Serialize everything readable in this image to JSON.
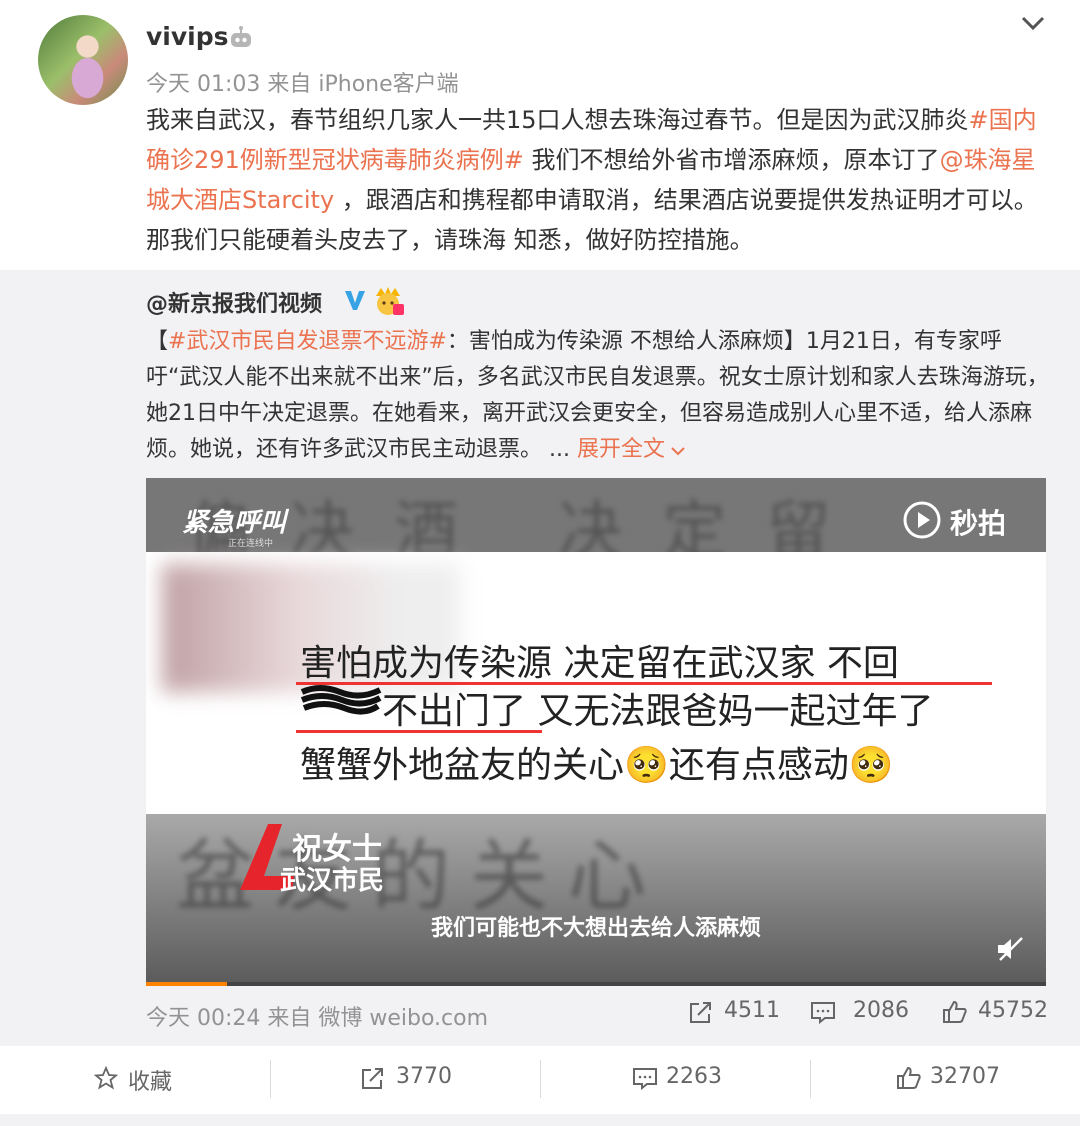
{
  "post": {
    "username": "vivips",
    "meta": "今天 01:03 来自 iPhone客户端",
    "text_1": "我来自武汉，春节组织几家人一共15口人想去珠海过春节。但是因为武汉肺炎",
    "hashtag": "#国内确诊291例新型冠状病毒肺炎病例#",
    "text_2": " 我们不想给外省市增添麻烦，原本订了",
    "mention": "@珠海星城大酒店Starcity",
    "text_3": " ，跟酒店和携程都申请取消，结果酒店说要提供发热证明才可以。那我们只能硬着头皮去了，请珠海 知悉，做好防控措施。"
  },
  "repost": {
    "author": "@新京报我们视频",
    "text_open": "【",
    "hashtag": "#武汉市民自发退票不远游#",
    "text_body": "：害怕成为传染源 不想给人添麻烦】1月21日，有专家呼吁“武汉人能不出来就不出来”后，多名武汉市民自发退票。祝女士原计划和家人去珠海游玩，她21日中午决定退票。在她看来，离开武汉会更安全，但容易造成别人心里不适，给人添麻烦。她说，还有许多武汉市民主动退票。 ... ",
    "expand": "展开全文",
    "meta": "今天 00:24 来自 微博 weibo.com",
    "stats": {
      "reposts": "4511",
      "comments": "2086",
      "likes": "45752"
    }
  },
  "video": {
    "top_blur": "偏决酒 决定留",
    "logo": "紧急呼叫",
    "logo_sub": "正在连线中",
    "brand": "秒拍",
    "line1": "害怕成为传染源 决定留在武汉家 不回",
    "line2": "不出门了 又无法跟爸妈一起过年了",
    "line3": "蟹蟹外地盆友的关心🥺还有点感动🥺",
    "bottom_blur": "盆友的关心",
    "speaker_name": "祝女士",
    "speaker_role": "武汉市民",
    "subtitle": "我们可能也不大想出去给人添麻烦",
    "progress": 0.09
  },
  "actions": {
    "favorite": "收藏",
    "repost": "3770",
    "comment": "2263",
    "like": "32707"
  },
  "colors": {
    "link": "#eb7350",
    "accent": "#ff8200"
  }
}
